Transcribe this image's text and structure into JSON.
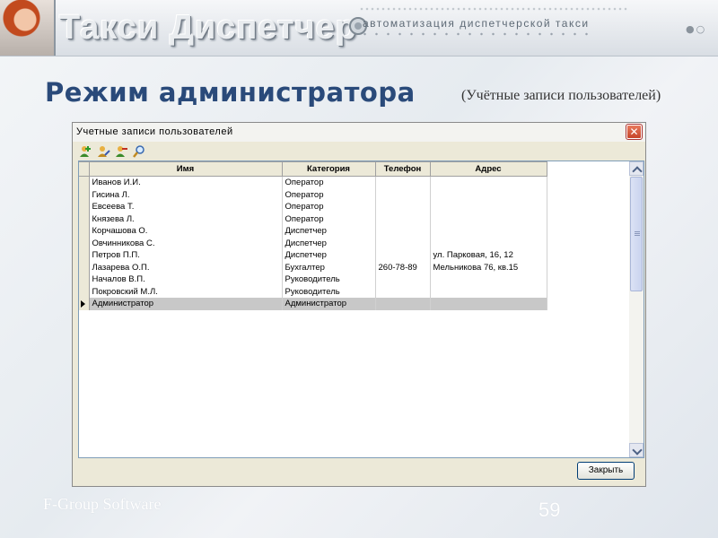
{
  "banner": {
    "title": "Такси Диспетчер",
    "subtitle": "автоматизация диспетчерской такси"
  },
  "slide": {
    "heading": "Режим администратора",
    "subheading": "(Учётные записи пользователей)",
    "footer_left": "F-Group Software",
    "page_number": "59"
  },
  "window": {
    "title": "Учетные записи пользователей",
    "close_button_label": "Закрыть",
    "toolbar_icons": [
      "add-user-icon",
      "edit-user-icon",
      "delete-user-icon",
      "search-icon"
    ]
  },
  "table": {
    "columns": [
      "Имя",
      "Категория",
      "Телефон",
      "Адрес"
    ],
    "rows": [
      {
        "name": "Иванов И.И.",
        "category": "Оператор",
        "phone": "",
        "address": ""
      },
      {
        "name": "Гисина Л.",
        "category": "Оператор",
        "phone": "",
        "address": ""
      },
      {
        "name": "Евсеева Т.",
        "category": "Оператор",
        "phone": "",
        "address": ""
      },
      {
        "name": "Князева Л.",
        "category": "Оператор",
        "phone": "",
        "address": ""
      },
      {
        "name": "Корчашова О.",
        "category": "Диспетчер",
        "phone": "",
        "address": ""
      },
      {
        "name": "Овчинникова С.",
        "category": "Диспетчер",
        "phone": "",
        "address": ""
      },
      {
        "name": "Петров П.П.",
        "category": "Диспетчер",
        "phone": "",
        "address": "ул. Парковая, 16, 12"
      },
      {
        "name": "Лазарева О.П.",
        "category": "Бухгалтер",
        "phone": "260-78-89",
        "address": "Мельникова 76, кв.15"
      },
      {
        "name": "Началов В.П.",
        "category": "Руководитель",
        "phone": "",
        "address": ""
      },
      {
        "name": "Покровский М.Л.",
        "category": "Руководитель",
        "phone": "",
        "address": ""
      },
      {
        "name": "Администратор",
        "category": "Администратор",
        "phone": "",
        "address": ""
      }
    ],
    "selected_row": 10
  }
}
